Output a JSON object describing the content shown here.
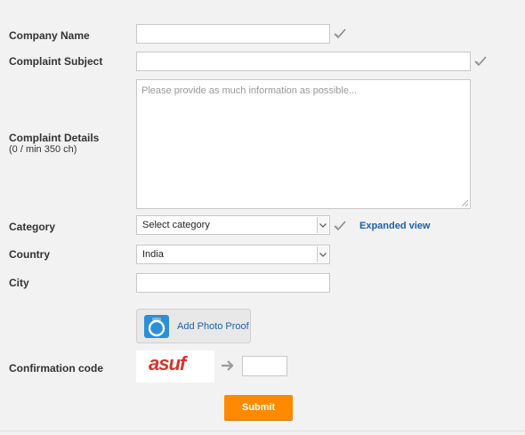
{
  "fields": {
    "company_name": {
      "label": "Company Name",
      "value": ""
    },
    "complaint_subject": {
      "label": "Complaint Subject",
      "value": ""
    },
    "complaint_details": {
      "label": "Complaint Details",
      "counter": "(0 / min 350 ch)",
      "placeholder": "Please provide as much information as possible..."
    },
    "category": {
      "label": "Category",
      "selected": "Select category",
      "expanded_link": "Expanded view"
    },
    "country": {
      "label": "Country",
      "selected": "India"
    },
    "city": {
      "label": "City",
      "value": ""
    },
    "photo": {
      "button_label": "Add Photo Proof",
      "icon": "camera-icon"
    },
    "confirmation": {
      "label": "Confirmation code",
      "captcha_text": "asuf",
      "value": ""
    }
  },
  "submit_label": "Submit",
  "colors": {
    "background": "#f2f2f2",
    "accent_orange": "#ff8a00",
    "link_blue": "#1f5fa8",
    "captcha_red": "#d6342a",
    "camera_blue": "#2d8fd6"
  }
}
